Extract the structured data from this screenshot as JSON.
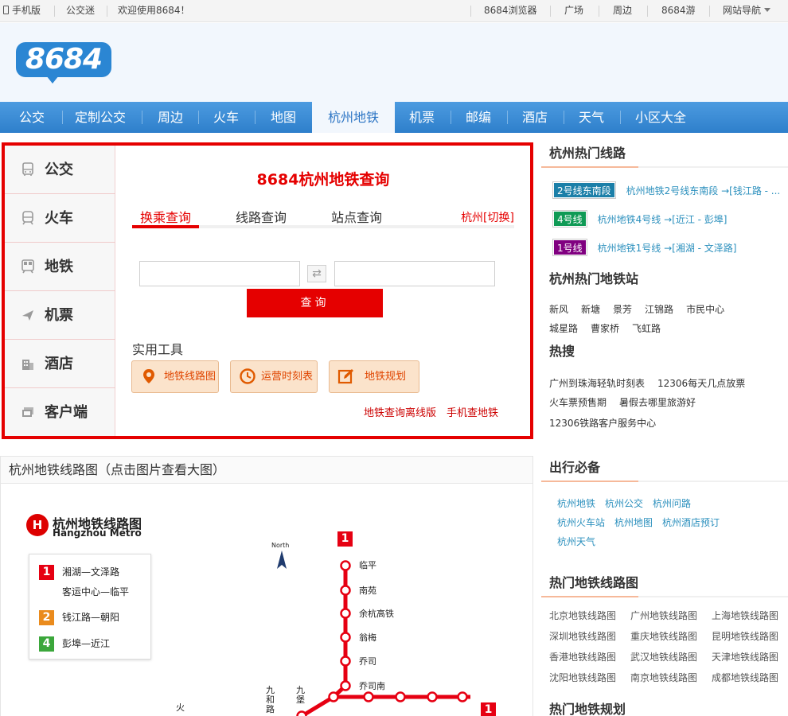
{
  "topbar": {
    "mobile": "手机版",
    "bus_fans": "公交迷",
    "welcome": "欢迎使用8684！",
    "browser": "8684浏览器",
    "square": "广场",
    "nearby": "周边",
    "travel": "8684游",
    "site_nav": "网站导航"
  },
  "logo": {
    "text": "8684"
  },
  "nav": [
    {
      "label": "公交"
    },
    {
      "label": "定制公交"
    },
    {
      "label": "周边"
    },
    {
      "label": "火车"
    },
    {
      "label": "地图"
    },
    {
      "label": "杭州地铁",
      "active": true
    },
    {
      "label": "机票"
    },
    {
      "label": "邮编"
    },
    {
      "label": "酒店"
    },
    {
      "label": "天气"
    },
    {
      "label": "小区大全"
    }
  ],
  "sidebar": [
    {
      "label": "公交",
      "icon": "bus-icon"
    },
    {
      "label": "火车",
      "icon": "train-icon"
    },
    {
      "label": "地铁",
      "icon": "subway-icon"
    },
    {
      "label": "机票",
      "icon": "plane-icon"
    },
    {
      "label": "酒店",
      "icon": "hotel-icon"
    },
    {
      "label": "客户端",
      "icon": "client-icon"
    }
  ],
  "query": {
    "title": "8684杭州地铁查询",
    "tabs": [
      "换乘查询",
      "线路查询",
      "站点查询"
    ],
    "city_switch": "杭州[切换]",
    "from_value": "",
    "to_value": "",
    "search_button": "查询",
    "tools_title": "实用工具",
    "tools": [
      "地铁线路图",
      "运营时刻表",
      "地铁规划"
    ],
    "offline_link": "地铁查询离线版",
    "mobile_link": "手机查地铁"
  },
  "map": {
    "heading": "杭州地铁线路图（点击图片查看大图）",
    "brand_cn": "杭州地铁线路图",
    "brand_en": "Hangzhou Metro",
    "brand_logo": "H",
    "north": "North",
    "legend": [
      {
        "num": "1",
        "text": "湘湖—文泽路",
        "color": "#e60012"
      },
      {
        "num": "",
        "text": "客运中心—临平",
        "color": "#e60012"
      },
      {
        "num": "2",
        "text": "钱江路—朝阳",
        "color": "#ea8b1d"
      },
      {
        "num": "4",
        "text": "彭埠—近江",
        "color": "#3ba73b"
      }
    ],
    "line_badge": "1",
    "stations": [
      "临平",
      "南苑",
      "余杭高铁",
      "翁梅",
      "乔司",
      "乔司南"
    ],
    "vertical_stations": [
      "九和路",
      "九堡",
      "火"
    ],
    "line_color": "#e60012"
  },
  "right": {
    "hot_lines_title": "杭州热门线路",
    "hot_lines": [
      {
        "badge": "2号线东南段",
        "color": "#1b7fa8",
        "text": "杭州地铁2号线东南段 →[钱江路 - ..."
      },
      {
        "badge": "4号线",
        "color": "#0f9a55",
        "text": "杭州地铁4号线 →[近江 - 彭埠]"
      },
      {
        "badge": "1号线",
        "color": "#800080",
        "text": "杭州地铁1号线 →[湘湖 - 文泽路]"
      }
    ],
    "hot_stations_title": "杭州热门地铁站",
    "hot_stations_row1": [
      "新风",
      "新塘",
      "景芳",
      "江锦路",
      "市民中心"
    ],
    "hot_stations_row2": [
      "城星路",
      "曹家桥",
      "飞虹路"
    ],
    "hot_search_title": "热搜",
    "hot_search_row1": [
      "广州到珠海轻轨时刻表",
      "12306每天几点放票"
    ],
    "hot_search_row2": [
      "火车票预售期",
      "暑假去哪里旅游好"
    ],
    "hot_search_row3": [
      "12306铁路客户服务中心"
    ],
    "travel_title": "出行必备",
    "travel_row1": [
      "杭州地铁",
      "杭州公交",
      "杭州问路"
    ],
    "travel_row2": [
      "杭州火车站",
      "杭州地图",
      "杭州酒店预订"
    ],
    "travel_row3": [
      "杭州天气"
    ],
    "hot_maps_title": "热门地铁线路图",
    "hot_maps_row1": [
      "北京地铁线路图",
      "广州地铁线路图",
      "上海地铁线路图"
    ],
    "hot_maps_row2": [
      "深圳地铁线路图",
      "重庆地铁线路图",
      "昆明地铁线路图"
    ],
    "hot_maps_row3": [
      "香港地铁线路图",
      "武汉地铁线路图",
      "天津地铁线路图"
    ],
    "hot_maps_row4": [
      "沈阳地铁线路图",
      "南京地铁线路图",
      "成都地铁线路图"
    ],
    "planning_title": "热门地铁规划"
  }
}
